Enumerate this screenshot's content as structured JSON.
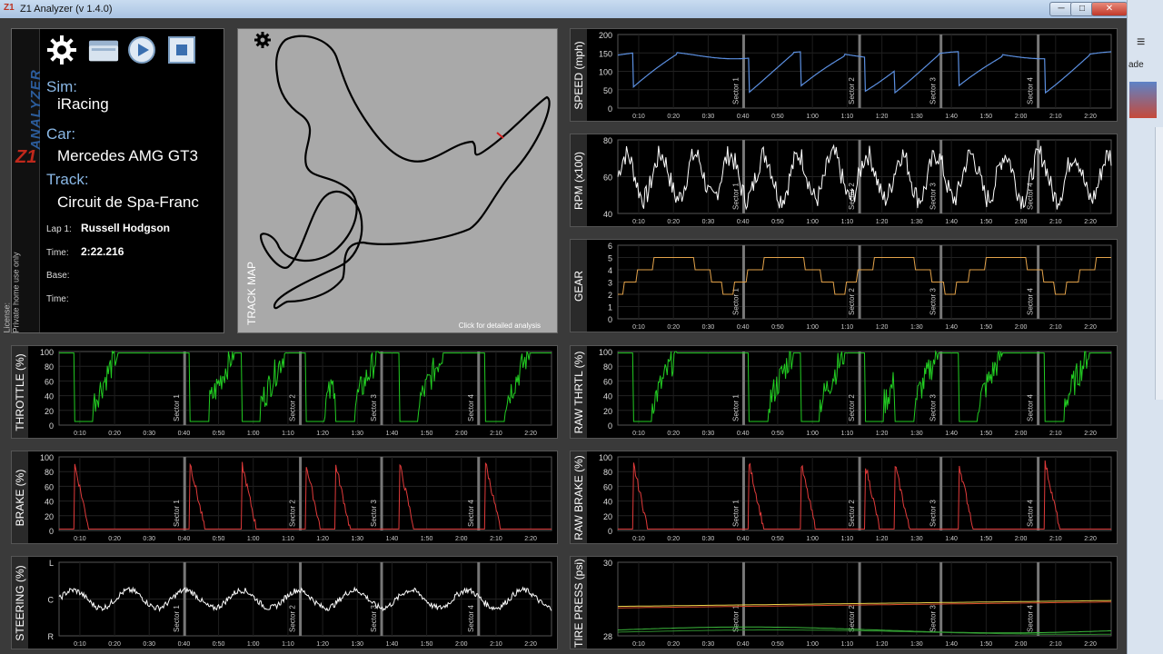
{
  "window": {
    "title": "Z1 Analyzer (v 1.4.0)",
    "minimize": "─",
    "maximize": "□",
    "close": "✕"
  },
  "right_strip": {
    "menu": "≡",
    "fragment": "ade"
  },
  "info": {
    "sim_label": "Sim:",
    "sim_value": "iRacing",
    "car_label": "Car:",
    "car_value": "Mercedes AMG GT3",
    "track_label": "Track:",
    "track_value": "Circuit de Spa-Franc",
    "lap_label": "Lap 1:",
    "driver": "Russell Hodgson",
    "time_label": "Time:",
    "time_value": "2:22.216",
    "base_label": "Base:",
    "base_time_label": "Time:",
    "license": "License:\nPrivate home use only",
    "logo_text": "ANALYZER",
    "logo_z1": "Z1"
  },
  "icons": [
    "gear-icon",
    "folder-icon",
    "play-icon",
    "stop-icon"
  ],
  "track_map": {
    "label": "TRACK MAP",
    "hint": "Click for detailed analysis"
  },
  "time_ticks": [
    "0:10",
    "0:20",
    "0:30",
    "0:40",
    "0:50",
    "1:00",
    "1:10",
    "1:20",
    "1:30",
    "1:40",
    "1:50",
    "2:00",
    "2:10",
    "2:20"
  ],
  "sectors": [
    "Sector 1",
    "Sector 2",
    "Sector 3",
    "Sector 4"
  ],
  "colors": {
    "speed": "#5b8fe0",
    "rpm": "#ffffff",
    "gear": "#e2a24a",
    "throttle": "#22cc22",
    "brake": "#e03a3a",
    "steering": "#ffffff",
    "tire_a": "#e8d24a",
    "tire_b": "#d84a2a",
    "tire_c": "#3cbb3c",
    "tire_d": "#2f8f2f"
  },
  "charts": [
    {
      "id": "speed",
      "label": "SPEED (mph)",
      "yticks": [
        "200",
        "150",
        "100",
        "50",
        "0"
      ],
      "color": "#5b8fe0"
    },
    {
      "id": "rpm",
      "label": "RPM (x100)",
      "yticks": [
        "80",
        "60",
        "40"
      ],
      "color": "#ffffff"
    },
    {
      "id": "gear",
      "label": "GEAR",
      "yticks": [
        "6",
        "5",
        "4",
        "3",
        "2",
        "1",
        "0"
      ],
      "color": "#e2a24a"
    },
    {
      "id": "throttle",
      "label": "THROTTLE (%)",
      "yticks": [
        "100",
        "80",
        "60",
        "40",
        "20",
        "0"
      ],
      "color": "#22cc22"
    },
    {
      "id": "rawthrottle",
      "label": "RAW THRTL (%)",
      "yticks": [
        "100",
        "80",
        "60",
        "40",
        "20",
        "0"
      ],
      "color": "#22cc22"
    },
    {
      "id": "brake",
      "label": "BRAKE (%)",
      "yticks": [
        "100",
        "80",
        "60",
        "40",
        "20",
        "0"
      ],
      "color": "#e03a3a"
    },
    {
      "id": "rawbrake",
      "label": "RAW BRAKE (%)",
      "yticks": [
        "100",
        "80",
        "60",
        "40",
        "20",
        "0"
      ],
      "color": "#e03a3a"
    },
    {
      "id": "steering",
      "label": "STEERING (%)",
      "yticks": [
        "L",
        "C",
        "R"
      ],
      "color": "#ffffff"
    },
    {
      "id": "tirepress",
      "label": "TIRE PRESS (psi)",
      "yticks": [
        "30",
        "28"
      ],
      "color": "#e8d24a"
    }
  ]
}
